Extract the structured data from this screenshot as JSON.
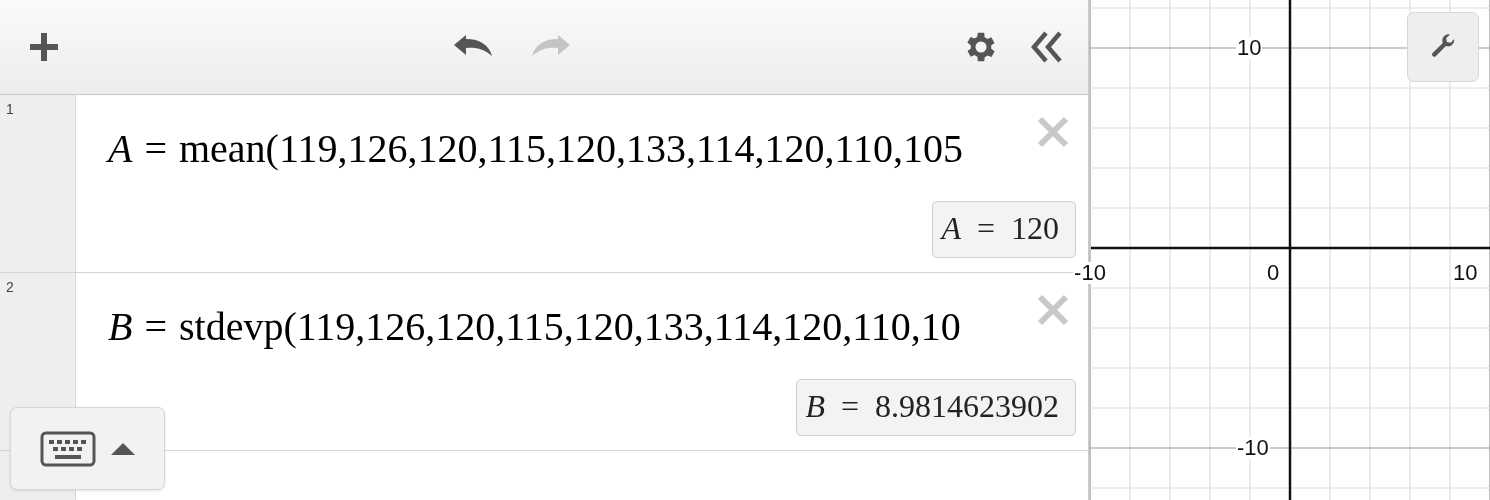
{
  "toolbar": [
    {
      "kind": "add",
      "disabled": false
    },
    {
      "kind": "undo",
      "disabled": false
    },
    {
      "kind": "redo",
      "disabled": true
    },
    {
      "kind": "settings",
      "disabled": false
    },
    {
      "kind": "collapse",
      "disabled": false
    }
  ],
  "expressions": [
    {
      "number": "1",
      "formula": "*A* = mean(119,126,120,115,120,133,114,120,110,105",
      "result": "*A* = 120"
    },
    {
      "number": "2",
      "formula": "*B* = stdevp(119,126,120,115,120,133,114,120,110,10",
      "result": "*B* = 8.9814623902"
    }
  ],
  "graph": {
    "x_tick_labels": [
      "-10",
      "0",
      "10"
    ],
    "y_tick_labels": [
      "10",
      "-10"
    ]
  }
}
